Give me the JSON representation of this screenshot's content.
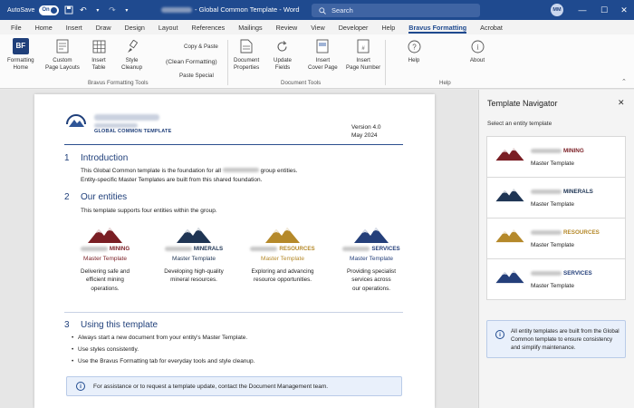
{
  "titlebar": {
    "autosave_label": "AutoSave",
    "autosave_state": "On",
    "doc_title": "- Global Common Template - Word",
    "search_placeholder": "Search",
    "user_initials": "MM"
  },
  "menu": {
    "tabs": [
      "File",
      "Home",
      "Insert",
      "Draw",
      "Design",
      "Layout",
      "References",
      "Mailings",
      "Review",
      "View",
      "Developer",
      "Help",
      "Bravus Formatting",
      "Acrobat"
    ],
    "active_tab": "Bravus Formatting"
  },
  "ribbon": {
    "formatting_home": "Formatting\nHome",
    "custom_page_layouts": "Custom\nPage Layouts",
    "insert_table": "Insert\nTable",
    "style_cleanup": "Style\nCleanup",
    "copy_paste": "Copy & Paste",
    "clean_formatting": "(Clean Formatting)",
    "paste_special": "Paste Special",
    "group_bravus_tools": "Bravus Formatting Tools",
    "document_properties": "Document\nProperties",
    "update_fields": "Update\nFields",
    "insert_cover_page": "Insert\nCover Page",
    "insert_page_number": "Insert\nPage Number",
    "group_document_tools": "Document Tools",
    "help": "Help",
    "about": "About",
    "group_help": "Help"
  },
  "document": {
    "header_label": "GLOBAL COMMON TEMPLATE",
    "version": "Version 4.0",
    "date": "May 2024",
    "section1": {
      "num": "1",
      "title": "Introduction",
      "line1_pre": "This Global Common template is the foundation for all",
      "line1_post": "group entities.",
      "line2": "Entity-specific Master Templates are built from this shared foundation."
    },
    "section2": {
      "num": "2",
      "title": "Our entities",
      "intro": "This template supports four entities within the group.",
      "entities": [
        {
          "name": "MINING",
          "template": "Master Template",
          "desc": "Delivering safe and\nefficient mining\noperations.",
          "color": "#7a1e24"
        },
        {
          "name": "MINERALS",
          "template": "Master Template",
          "desc": "Developing high-quality\nmineral resources.",
          "color": "#1f3554"
        },
        {
          "name": "RESOURCES",
          "template": "Master Template",
          "desc": "Exploring and advancing\nresource opportunities.",
          "color": "#b5892a"
        },
        {
          "name": "SERVICES",
          "template": "Master Template",
          "desc": "Providing specialist\nservices across\nour operations.",
          "color": "#243f7a"
        }
      ]
    },
    "section3": {
      "num": "3",
      "title": "Using this template",
      "bullets": [
        "Always start a new document from your entity's Master Template.",
        "Use styles consistently.",
        "Use the Bravus Formatting tab for everyday tools and style cleanup."
      ]
    },
    "info_note": "For assistance or to request a template update, contact the Document Management team."
  },
  "navigator": {
    "title": "Template Navigator",
    "subtitle": "Select an entity template",
    "cards": [
      {
        "name": "MINING",
        "template": "Master Template",
        "color": "#7a1e24"
      },
      {
        "name": "MINERALS",
        "template": "Master Template",
        "color": "#1f3554"
      },
      {
        "name": "RESOURCES",
        "template": "Master Template",
        "color": "#b5892a"
      },
      {
        "name": "SERVICES",
        "template": "Master Template",
        "color": "#243f7a"
      }
    ],
    "info": "All entity templates are built from the Global Common template to ensure consistency and simplify maintenance."
  },
  "colors": {
    "titlebar": "#1f4a8f",
    "accent": "#1f3f7a"
  }
}
